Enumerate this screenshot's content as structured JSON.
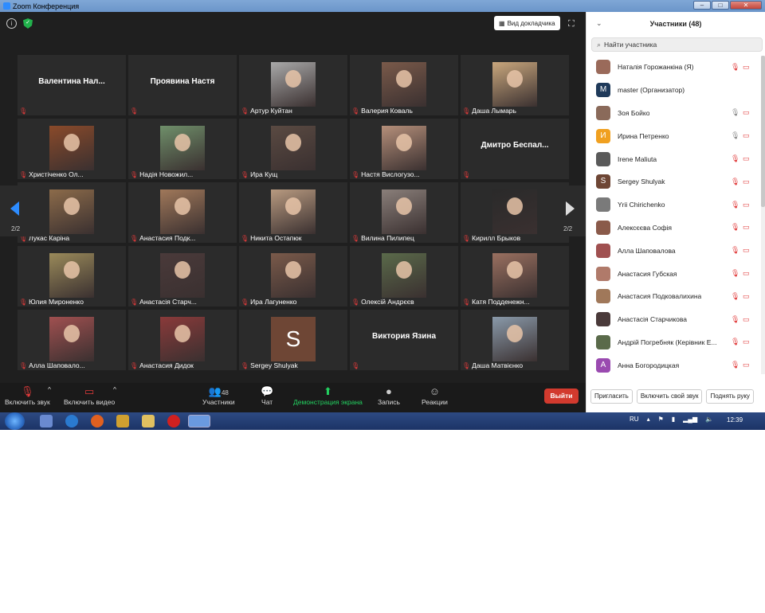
{
  "window": {
    "title": "Zoom Конференция"
  },
  "topbar": {
    "view_button": "Вид докладчика"
  },
  "tiles": [
    {
      "name": "Валентина  Нал...",
      "label": "",
      "type": "name"
    },
    {
      "name": "Проявина Настя",
      "label": "",
      "type": "name"
    },
    {
      "name": "",
      "label": "Артур Куйтан",
      "type": "photo",
      "color": "#a9a9a9"
    },
    {
      "name": "",
      "label": "Валерия Коваль",
      "type": "photo",
      "color": "#7a5a4a"
    },
    {
      "name": "",
      "label": "Даша Лымарь",
      "type": "photo",
      "color": "#c9a77d"
    },
    {
      "name": "",
      "label": "Христіченко Ол...",
      "type": "photo",
      "color": "#8a4a2a"
    },
    {
      "name": "",
      "label": "Надія Новожил...",
      "type": "photo",
      "color": "#6f8f6a"
    },
    {
      "name": "",
      "label": "Ира Кущ",
      "type": "photo",
      "color": "#5a4a42"
    },
    {
      "name": "",
      "label": "Настя Вислогузо...",
      "type": "photo",
      "color": "#b58f7a"
    },
    {
      "name": "Дмитро  Беспал...",
      "label": "",
      "type": "name"
    },
    {
      "name": "",
      "label": "Лукас Каріна",
      "type": "photo",
      "color": "#8c6b4a"
    },
    {
      "name": "",
      "label": "Анастасия Подк...",
      "type": "photo",
      "color": "#a0785a"
    },
    {
      "name": "",
      "label": "Никита Остапюк",
      "type": "photo",
      "color": "#b89a80"
    },
    {
      "name": "",
      "label": "Вилина Пилипец",
      "type": "photo",
      "color": "#8a7f7a"
    },
    {
      "name": "",
      "label": "Кирилл Брыков",
      "type": "photo",
      "color": "#2a2a2a"
    },
    {
      "name": "",
      "label": "Юлия Мироненко",
      "type": "photo",
      "color": "#9a8a5a"
    },
    {
      "name": "",
      "label": "Анастасія Старч...",
      "type": "photo",
      "color": "#4a3a3a"
    },
    {
      "name": "",
      "label": "Ира Лагуненко",
      "type": "photo",
      "color": "#7a5a4a"
    },
    {
      "name": "",
      "label": "Олексій Андрєєв",
      "type": "photo",
      "color": "#5a6a4a"
    },
    {
      "name": "",
      "label": "Катя Подденежн...",
      "type": "photo",
      "color": "#9a7060"
    },
    {
      "name": "",
      "label": "Алла Шаповало...",
      "type": "photo",
      "color": "#a05050"
    },
    {
      "name": "",
      "label": "Анастасия Дидок",
      "type": "photo",
      "color": "#8a3a3a"
    },
    {
      "name": "",
      "label": "Sergey Shulyak",
      "type": "avatar",
      "letter": "S"
    },
    {
      "name": "Виктория Язина",
      "label": "",
      "type": "name"
    },
    {
      "name": "",
      "label": "Даша Матвієнко",
      "type": "photo",
      "color": "#8a9aaa"
    }
  ],
  "pager": {
    "left": "2/2",
    "right": "2/2"
  },
  "toolbar": {
    "unmute": "Включить звук",
    "start_video": "Включить видео",
    "participants": "Участники",
    "participants_count": "48",
    "chat": "Чат",
    "share": "Демонстрация экрана",
    "record": "Запись",
    "reactions": "Реакции",
    "leave": "Выйти"
  },
  "panel": {
    "title": "Участники (48)",
    "search_placeholder": "Найти участника",
    "participants": [
      {
        "name": "Наталія Горожанкіна (Я)",
        "av": "",
        "av_color": "#9a6a5a",
        "mic": "muted"
      },
      {
        "name": "master (Организатор)",
        "av": "M",
        "av_color": "#1f3a5a",
        "mic": "none"
      },
      {
        "name": "Зоя Бойко",
        "av": "",
        "av_color": "#8a6a5a",
        "mic": "on"
      },
      {
        "name": "Ирина Петренко",
        "av": "И",
        "av_color": "#f0a020",
        "mic": "on"
      },
      {
        "name": "Irene Maliuta",
        "av": "",
        "av_color": "#5a5a5a",
        "mic": "muted"
      },
      {
        "name": "Sergey Shulyak",
        "av": "S",
        "av_color": "#6e4635",
        "mic": "muted"
      },
      {
        "name": "Yrii Chirichenko",
        "av": "",
        "av_color": "#7a7a7a",
        "mic": "muted"
      },
      {
        "name": "Алексєєва Софія",
        "av": "",
        "av_color": "#8a5a4a",
        "mic": "muted"
      },
      {
        "name": "Алла Шаповалова",
        "av": "",
        "av_color": "#a05050",
        "mic": "muted"
      },
      {
        "name": "Анастасия Губская",
        "av": "",
        "av_color": "#b07a6a",
        "mic": "muted"
      },
      {
        "name": "Анастасия Подковалихина",
        "av": "",
        "av_color": "#a0785a",
        "mic": "muted"
      },
      {
        "name": "Анастасія Старчикова",
        "av": "",
        "av_color": "#4a3a3a",
        "mic": "muted"
      },
      {
        "name": "Андрій Погребняк (Керівник Е...",
        "av": "",
        "av_color": "#5a6a4a",
        "mic": "muted"
      },
      {
        "name": "Анна Богородицкая",
        "av": "А",
        "av_color": "#9a4ab0",
        "mic": "muted"
      }
    ],
    "footer": {
      "invite": "Пригласить",
      "unmute_me": "Включить свой звук",
      "raise_hand": "Поднять руку"
    }
  },
  "taskbar": {
    "lang": "RU",
    "time": "12:39"
  }
}
